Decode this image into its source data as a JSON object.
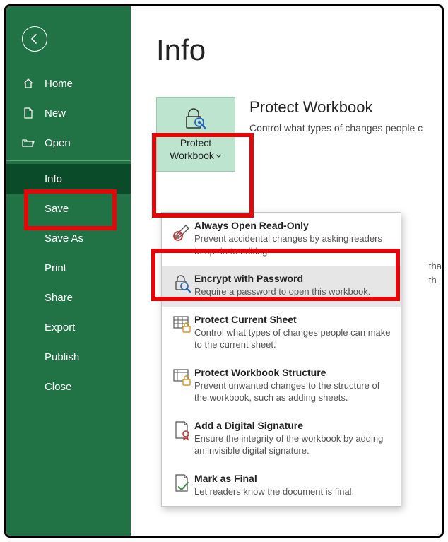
{
  "page": {
    "title": "Info"
  },
  "sidebar": {
    "items": [
      {
        "label": "Home"
      },
      {
        "label": "New"
      },
      {
        "label": "Open"
      },
      {
        "label": "Info"
      },
      {
        "label": "Save"
      },
      {
        "label": "Save As"
      },
      {
        "label": "Print"
      },
      {
        "label": "Share"
      },
      {
        "label": "Export"
      },
      {
        "label": "Publish"
      },
      {
        "label": "Close"
      }
    ]
  },
  "protect": {
    "button_line1": "Protect",
    "button_line2": "Workbook",
    "header": "Protect Workbook",
    "subtext": "Control what types of changes people c"
  },
  "side_text": {
    "line1": "tha",
    "line2": "th"
  },
  "menu": {
    "items": [
      {
        "title_pre": "Always ",
        "title_ul": "O",
        "title_post": "pen Read-Only",
        "desc": "Prevent accidental changes by asking readers to opt-in to editing."
      },
      {
        "title_pre": "",
        "title_ul": "E",
        "title_post": "ncrypt with Password",
        "desc": "Require a password to open this workbook."
      },
      {
        "title_pre": "",
        "title_ul": "P",
        "title_post": "rotect Current Sheet",
        "desc": "Control what types of changes people can make to the current sheet."
      },
      {
        "title_pre": "Protect ",
        "title_ul": "W",
        "title_post": "orkbook Structure",
        "desc": "Prevent unwanted changes to the structure of the workbook, such as adding sheets."
      },
      {
        "title_pre": "Add a Digital ",
        "title_ul": "S",
        "title_post": "ignature",
        "desc": "Ensure the integrity of the workbook by adding an invisible digital signature."
      },
      {
        "title_pre": "Mark as ",
        "title_ul": "F",
        "title_post": "inal",
        "desc": "Let readers know the document is final."
      }
    ]
  }
}
